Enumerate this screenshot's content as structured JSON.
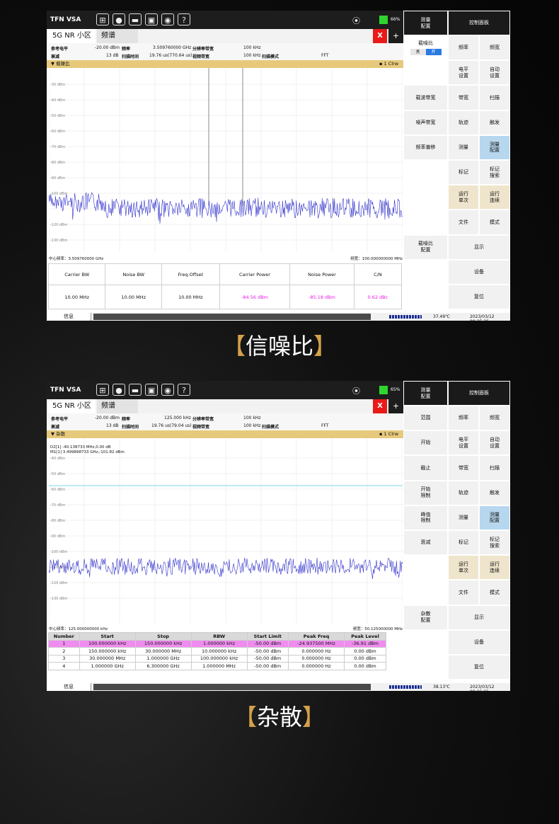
{
  "panels": [
    {
      "app_title": "TFN VSA",
      "battery": "66%",
      "tab_mode": "5G NR 小区",
      "tab_view": "频谱",
      "close_label": "X",
      "add_label": "+",
      "params": {
        "ref_level_label": "参考电平",
        "ref_level_value": "-20.00 dBm",
        "freq_label": "频率",
        "freq_value": "3.509760000 GHz",
        "rbw_label": "分辨率带宽",
        "rbw_value": "100 kHz",
        "atten_label": "衰减",
        "atten_value": "13 dB",
        "sweep_time_label": "扫描时间",
        "sweep_time_value": "19.76 us(770.64 us)",
        "vbw_label": "视频带宽",
        "vbw_value": "100 kHz",
        "sweep_mode_label": "扫描模式",
        "sweep_mode_value": "FFT"
      },
      "trace_title": "▼ 载噪比",
      "trace_info": "▪ 1 Clrw",
      "y_labels": [
        "-30 dBm",
        "-40 dBm",
        "-50 dBm",
        "-60 dBm",
        "-70 dBm",
        "-80 dBm",
        "-90 dBm",
        "-100 dBm",
        "",
        "-120 dBm",
        "-130 dBm"
      ],
      "center_freq": "中心频率：3.509760000 GHz",
      "span": "频宽：100.000000000 MHz",
      "measurements": {
        "headers": [
          "Carrier BW",
          "Noise BW",
          "Freq.Offset",
          "Carrier Power",
          "Noise Power",
          "C/N"
        ],
        "values": [
          "10.00 MHz",
          "10.00 MHz",
          "10.00 MHz",
          "-84.56 dBm",
          "-85.18 dBm",
          "0.62 dBc"
        ]
      },
      "sidebar": {
        "header_left": "测量\n配置",
        "header_right": "控制面板",
        "left": [
          "载噪比",
          "",
          "载波带宽",
          "噪声带宽",
          "频率偏移",
          "",
          "",
          "",
          "载噪比\n配置",
          "",
          ""
        ],
        "toggle_off": "关",
        "toggle_on": "开",
        "right_pairs": [
          [
            "频率",
            "频宽"
          ],
          [
            "电平\n设置",
            "自动\n设置"
          ],
          [
            "带宽",
            "扫描"
          ],
          [
            "轨迹",
            "触发"
          ],
          [
            "测量",
            "测量\n配置"
          ],
          [
            "标记",
            "标记\n搜索"
          ],
          [
            "运行\n单次",
            "运行\n连续"
          ],
          [
            "文件",
            "模式"
          ]
        ],
        "right_full": [
          "显示",
          "设备",
          "复位"
        ]
      },
      "status": {
        "info": "信息",
        "temp": "37.49℃",
        "clock": "2023/03/12 09:35:36"
      }
    },
    {
      "app_title": "TFN VSA",
      "battery": "65%",
      "tab_mode": "5G NR 小区",
      "tab_view": "频谱",
      "close_label": "X",
      "add_label": "+",
      "params": {
        "ref_level_label": "参考电平",
        "ref_level_value": "-20.00 dBm",
        "freq_label": "频率",
        "freq_value": "125.000 kHz",
        "rbw_label": "分辨率带宽",
        "rbw_value": "100 kHz",
        "atten_label": "衰减",
        "atten_value": "13 dB",
        "sweep_time_label": "扫描时间",
        "sweep_time_value": "19.76 us(79.04 us)",
        "vbw_label": "视频带宽",
        "vbw_value": "100 kHz",
        "sweep_mode_label": "扫描模式",
        "sweep_mode_value": "FFT"
      },
      "trace_title": "▼ 杂散",
      "trace_info": "▪ 1 Clrw",
      "markers": [
        "D2[1]      -40.138733 MHz,0.00 dB",
        "M1[1]      3.499898733 GHz,-101.82 dBm"
      ],
      "y_labels": [
        "-40 dBm",
        "-50 dBm",
        "-60 dBm",
        "-70 dBm",
        "-80 dBm",
        "-90 dBm",
        "-100 dBm",
        "-110 dBm",
        "-120 dBm",
        "-130 dBm"
      ],
      "center_freq": "中心频率：125.000000000 kHz",
      "span": "频宽：50.125000000 MHz",
      "spur_table": {
        "headers": [
          "Number",
          "Start",
          "Stop",
          "RBW",
          "Start Limit",
          "Peak Freq",
          "Peak Level"
        ],
        "rows": [
          [
            "1",
            "100.000000 kHz",
            "150.000000 kHz",
            "1.000000 kHz",
            "-50.00 dBm",
            "-24.937500 MHz",
            "-36.91 dBm"
          ],
          [
            "2",
            "150.000000 kHz",
            "30.000000 MHz",
            "10.000000 kHz",
            "-50.00 dBm",
            "0.000000 Hz",
            "0.00 dBm"
          ],
          [
            "3",
            "30.000000 MHz",
            "1.000000 GHz",
            "100.000000 kHz",
            "-50.00 dBm",
            "0.000000 Hz",
            "0.00 dBm"
          ],
          [
            "4",
            "1.000000 GHz",
            "6.300000 GHz",
            "1.000000 MHz",
            "-50.00 dBm",
            "0.000000 Hz",
            "0.00 dBm"
          ]
        ]
      },
      "sidebar": {
        "header_left": "测量\n配置",
        "header_right": "控制面板",
        "left": [
          "范围",
          "开始",
          "截止",
          "开始\n限制",
          "峰值\n限制",
          "衰减",
          "",
          "",
          "杂散\n配置",
          "",
          ""
        ],
        "right_pairs": [
          [
            "频率",
            "频宽"
          ],
          [
            "电平\n设置",
            "自动\n设置"
          ],
          [
            "带宽",
            "扫描"
          ],
          [
            "轨迹",
            "触发"
          ],
          [
            "测量",
            "测量\n配置"
          ],
          [
            "标记",
            "标记\n搜索"
          ],
          [
            "运行\n单次",
            "运行\n连续"
          ],
          [
            "文件",
            "模式"
          ]
        ],
        "right_full": [
          "显示",
          "设备",
          "复位"
        ]
      },
      "status": {
        "info": "信息",
        "temp": "38.13℃",
        "clock": "2023/03/12 09:36:21"
      }
    }
  ],
  "captions": [
    {
      "open": "【",
      "text": "信噪比",
      "close": "】"
    },
    {
      "open": "【",
      "text": "杂散",
      "close": "】"
    }
  ],
  "colors": {
    "trace": "#3333cc",
    "limit_line": "#7fd3e6",
    "accent_tan": "#e7c97b",
    "highlight_blue": "#b7d7ee",
    "c_n_value": "#e81ae8"
  },
  "icons": [
    "windows-icon",
    "lightbulb-icon",
    "folder-icon",
    "save-icon",
    "camera-icon",
    "help-icon",
    "gps-icon",
    "battery-icon"
  ]
}
